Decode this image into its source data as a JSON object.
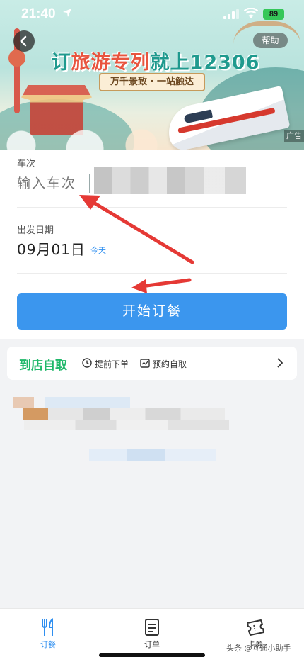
{
  "status_bar": {
    "time": "21:40",
    "battery": "89"
  },
  "header": {
    "help_label": "帮助",
    "ad_label": "广告"
  },
  "banner": {
    "title_part1": "订",
    "title_part2": "旅游专列",
    "title_part3": "就上12306",
    "subtitle": "万千景致 · 一站触达"
  },
  "form": {
    "train_label": "车次",
    "train_placeholder": "输入车次",
    "date_label": "出发日期",
    "date_value": "09月01日",
    "date_note": "今天",
    "submit_label": "开始订餐"
  },
  "pickup": {
    "title": "到店自取",
    "feature1": "提前下单",
    "feature2": "预约自取"
  },
  "tabs": [
    {
      "label": "订餐",
      "icon": "fork-knife-icon",
      "active": true
    },
    {
      "label": "订单",
      "icon": "order-list-icon",
      "active": false
    },
    {
      "label": "卡券",
      "icon": "ticket-icon",
      "active": false
    }
  ],
  "watermark": "头条 @互通小助手",
  "colors": {
    "primary": "#3b96ee",
    "accent_green": "#1fb86a",
    "annotation_red": "#e53935"
  }
}
